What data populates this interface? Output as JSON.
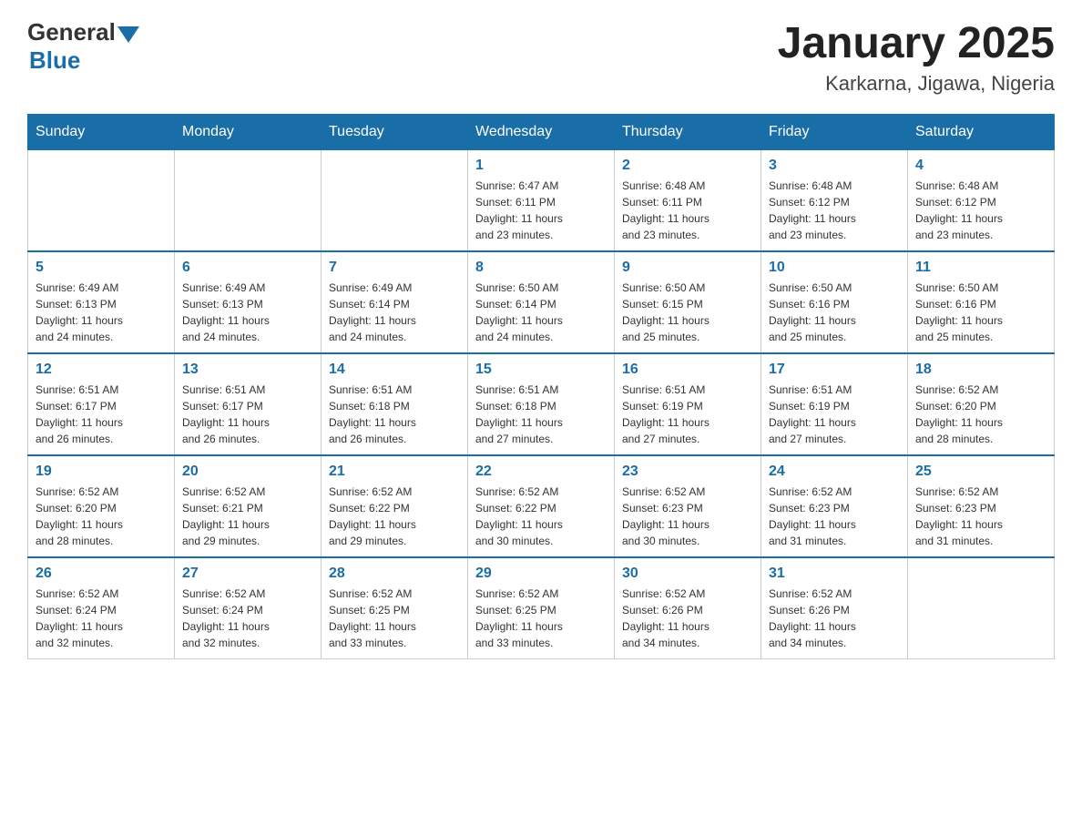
{
  "header": {
    "logo_general": "General",
    "logo_blue": "Blue",
    "month_year": "January 2025",
    "location": "Karkarna, Jigawa, Nigeria"
  },
  "days_of_week": [
    "Sunday",
    "Monday",
    "Tuesday",
    "Wednesday",
    "Thursday",
    "Friday",
    "Saturday"
  ],
  "weeks": [
    [
      {
        "day": "",
        "info": ""
      },
      {
        "day": "",
        "info": ""
      },
      {
        "day": "",
        "info": ""
      },
      {
        "day": "1",
        "info": "Sunrise: 6:47 AM\nSunset: 6:11 PM\nDaylight: 11 hours\nand 23 minutes."
      },
      {
        "day": "2",
        "info": "Sunrise: 6:48 AM\nSunset: 6:11 PM\nDaylight: 11 hours\nand 23 minutes."
      },
      {
        "day": "3",
        "info": "Sunrise: 6:48 AM\nSunset: 6:12 PM\nDaylight: 11 hours\nand 23 minutes."
      },
      {
        "day": "4",
        "info": "Sunrise: 6:48 AM\nSunset: 6:12 PM\nDaylight: 11 hours\nand 23 minutes."
      }
    ],
    [
      {
        "day": "5",
        "info": "Sunrise: 6:49 AM\nSunset: 6:13 PM\nDaylight: 11 hours\nand 24 minutes."
      },
      {
        "day": "6",
        "info": "Sunrise: 6:49 AM\nSunset: 6:13 PM\nDaylight: 11 hours\nand 24 minutes."
      },
      {
        "day": "7",
        "info": "Sunrise: 6:49 AM\nSunset: 6:14 PM\nDaylight: 11 hours\nand 24 minutes."
      },
      {
        "day": "8",
        "info": "Sunrise: 6:50 AM\nSunset: 6:14 PM\nDaylight: 11 hours\nand 24 minutes."
      },
      {
        "day": "9",
        "info": "Sunrise: 6:50 AM\nSunset: 6:15 PM\nDaylight: 11 hours\nand 25 minutes."
      },
      {
        "day": "10",
        "info": "Sunrise: 6:50 AM\nSunset: 6:16 PM\nDaylight: 11 hours\nand 25 minutes."
      },
      {
        "day": "11",
        "info": "Sunrise: 6:50 AM\nSunset: 6:16 PM\nDaylight: 11 hours\nand 25 minutes."
      }
    ],
    [
      {
        "day": "12",
        "info": "Sunrise: 6:51 AM\nSunset: 6:17 PM\nDaylight: 11 hours\nand 26 minutes."
      },
      {
        "day": "13",
        "info": "Sunrise: 6:51 AM\nSunset: 6:17 PM\nDaylight: 11 hours\nand 26 minutes."
      },
      {
        "day": "14",
        "info": "Sunrise: 6:51 AM\nSunset: 6:18 PM\nDaylight: 11 hours\nand 26 minutes."
      },
      {
        "day": "15",
        "info": "Sunrise: 6:51 AM\nSunset: 6:18 PM\nDaylight: 11 hours\nand 27 minutes."
      },
      {
        "day": "16",
        "info": "Sunrise: 6:51 AM\nSunset: 6:19 PM\nDaylight: 11 hours\nand 27 minutes."
      },
      {
        "day": "17",
        "info": "Sunrise: 6:51 AM\nSunset: 6:19 PM\nDaylight: 11 hours\nand 27 minutes."
      },
      {
        "day": "18",
        "info": "Sunrise: 6:52 AM\nSunset: 6:20 PM\nDaylight: 11 hours\nand 28 minutes."
      }
    ],
    [
      {
        "day": "19",
        "info": "Sunrise: 6:52 AM\nSunset: 6:20 PM\nDaylight: 11 hours\nand 28 minutes."
      },
      {
        "day": "20",
        "info": "Sunrise: 6:52 AM\nSunset: 6:21 PM\nDaylight: 11 hours\nand 29 minutes."
      },
      {
        "day": "21",
        "info": "Sunrise: 6:52 AM\nSunset: 6:22 PM\nDaylight: 11 hours\nand 29 minutes."
      },
      {
        "day": "22",
        "info": "Sunrise: 6:52 AM\nSunset: 6:22 PM\nDaylight: 11 hours\nand 30 minutes."
      },
      {
        "day": "23",
        "info": "Sunrise: 6:52 AM\nSunset: 6:23 PM\nDaylight: 11 hours\nand 30 minutes."
      },
      {
        "day": "24",
        "info": "Sunrise: 6:52 AM\nSunset: 6:23 PM\nDaylight: 11 hours\nand 31 minutes."
      },
      {
        "day": "25",
        "info": "Sunrise: 6:52 AM\nSunset: 6:23 PM\nDaylight: 11 hours\nand 31 minutes."
      }
    ],
    [
      {
        "day": "26",
        "info": "Sunrise: 6:52 AM\nSunset: 6:24 PM\nDaylight: 11 hours\nand 32 minutes."
      },
      {
        "day": "27",
        "info": "Sunrise: 6:52 AM\nSunset: 6:24 PM\nDaylight: 11 hours\nand 32 minutes."
      },
      {
        "day": "28",
        "info": "Sunrise: 6:52 AM\nSunset: 6:25 PM\nDaylight: 11 hours\nand 33 minutes."
      },
      {
        "day": "29",
        "info": "Sunrise: 6:52 AM\nSunset: 6:25 PM\nDaylight: 11 hours\nand 33 minutes."
      },
      {
        "day": "30",
        "info": "Sunrise: 6:52 AM\nSunset: 6:26 PM\nDaylight: 11 hours\nand 34 minutes."
      },
      {
        "day": "31",
        "info": "Sunrise: 6:52 AM\nSunset: 6:26 PM\nDaylight: 11 hours\nand 34 minutes."
      },
      {
        "day": "",
        "info": ""
      }
    ]
  ]
}
